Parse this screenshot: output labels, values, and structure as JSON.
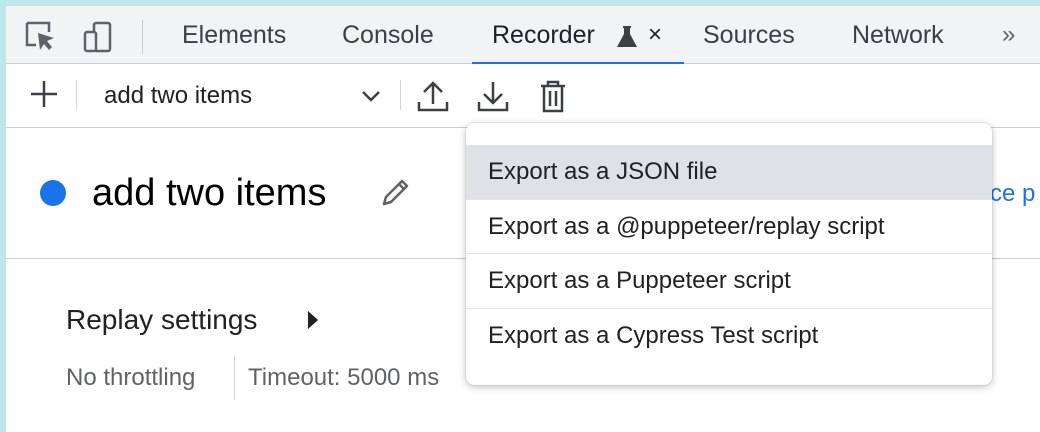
{
  "tabs": {
    "items": [
      "Elements",
      "Console",
      "Recorder",
      "Sources",
      "Network"
    ],
    "close": "×",
    "more": "»"
  },
  "toolbar": {
    "recording_select_value": "add two items"
  },
  "recording": {
    "title": "add two items",
    "cut_link": "ce p"
  },
  "replay": {
    "title": "Replay settings",
    "throttling": "No throttling",
    "timeout": "Timeout: 5000 ms"
  },
  "export_menu": {
    "items": [
      "Export as a JSON file",
      "Export as a @puppeteer/replay script",
      "Export as a Puppeteer script",
      "Export as a Cypress Test script"
    ]
  },
  "colors": {
    "accent": "#1a73e8",
    "tab_bar": "#f1f3f4",
    "menu_hover": "#dfe1e5"
  },
  "icons": [
    "inspect-element-icon",
    "device-toolbar-icon",
    "flask-icon",
    "plus-icon",
    "chevron-down-icon",
    "upload-icon",
    "download-icon",
    "trash-icon",
    "pencil-icon",
    "caret-right-icon"
  ]
}
